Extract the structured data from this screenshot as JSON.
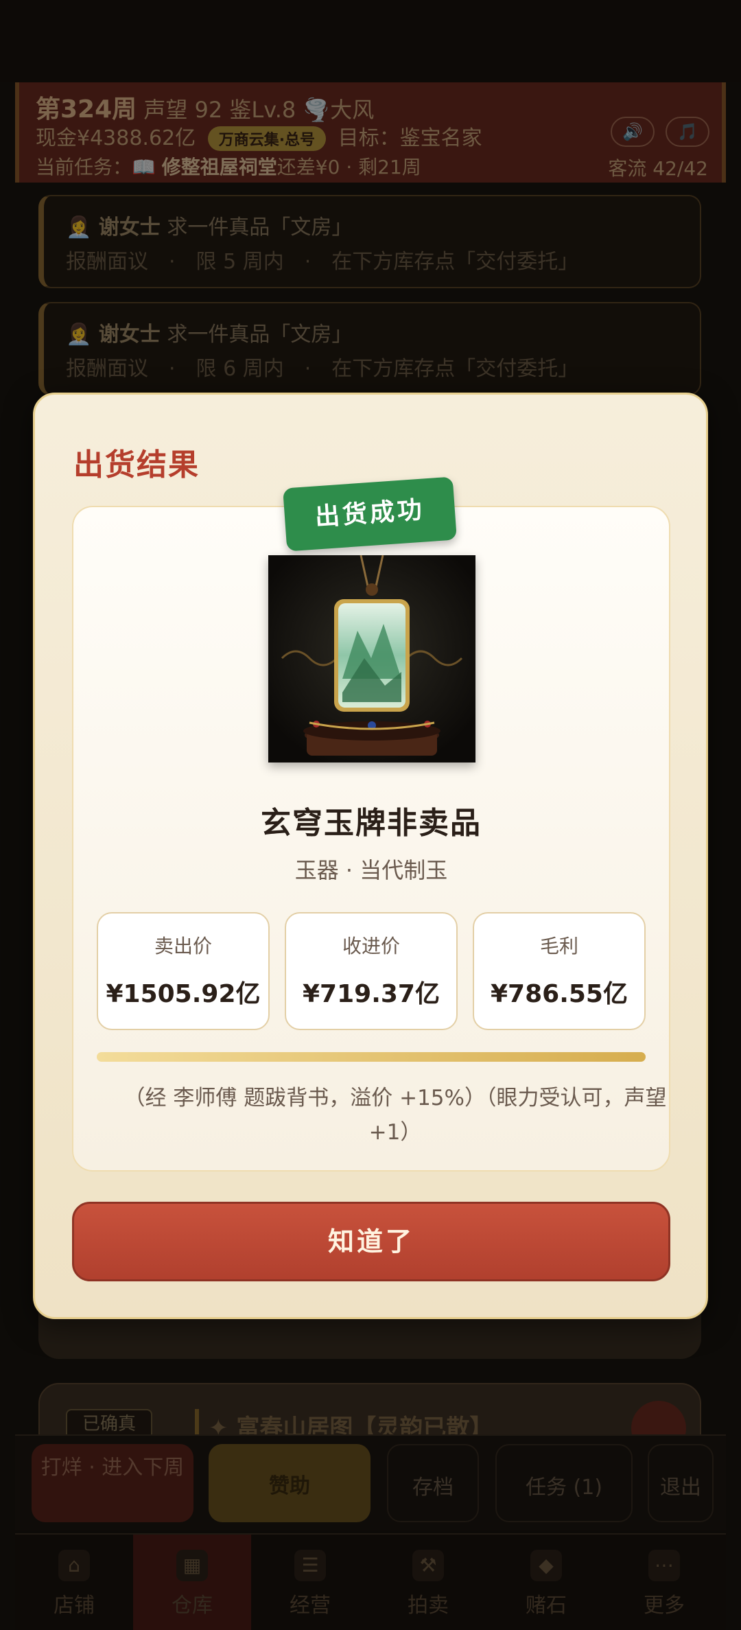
{
  "status": {
    "week": "第324周",
    "prestige": "声望 92",
    "appraise": "鉴Lv.8",
    "weather": "🌪️大风",
    "cash": "现金¥4388.62亿",
    "guild_tag": "万商云集·总号",
    "goal": "目标：鉴宝名家",
    "task_prefix": "当前任务：📖",
    "task_name": "修整祖屋祠堂",
    "task_gap": "还差¥0",
    "task_left": "· 剩21周",
    "flow": "客流 42/42",
    "sound_icon": "🔊",
    "music_icon": "🎵"
  },
  "requests": [
    {
      "who": "👩‍💼 谢女士",
      "want": "求一件真品「文房」",
      "detail": "报酬面议　·　限 5 周内　·　在下方库存点「交付委托」"
    },
    {
      "who": "👩‍💼 谢女士",
      "want": "求一件真品「文房」",
      "detail": "报酬面议　·　限 6 周内　·　在下方库存点「交付委托」"
    }
  ],
  "inventory_card": {
    "badge": "已确真",
    "name": "✦ 富春山居图【灵韵已散】"
  },
  "actions": {
    "close_shop": "打烊 · 进入下周",
    "sponsor": "赞助",
    "save": "存档",
    "tasks": "任务 (1)",
    "quit": "退出"
  },
  "tabs": [
    {
      "label": "店铺",
      "icon": "shop-icon"
    },
    {
      "label": "仓库",
      "icon": "warehouse-icon"
    },
    {
      "label": "经营",
      "icon": "ledger-icon"
    },
    {
      "label": "拍卖",
      "icon": "auction-icon"
    },
    {
      "label": "赌石",
      "icon": "stone-icon"
    },
    {
      "label": "更多",
      "icon": "more-icon"
    }
  ],
  "modal": {
    "title": "出货结果",
    "stamp": "出货成功",
    "item_name": "玄穹玉牌非卖品",
    "item_category": "玉器 · 当代制玉",
    "stats": [
      {
        "label": "卖出价",
        "value": "¥1505.92亿"
      },
      {
        "label": "收进价",
        "value": "¥719.37亿"
      },
      {
        "label": "毛利",
        "value": "¥786.55亿"
      }
    ],
    "note": "（经 李师傅 题跋背书，溢价 +15%）（眼力受认可，声望 +1）",
    "confirm": "知道了"
  },
  "colors": {
    "accent_red": "#b53e2c",
    "success_green": "#2e8d4b",
    "modal_bg": "#f6eedb"
  }
}
